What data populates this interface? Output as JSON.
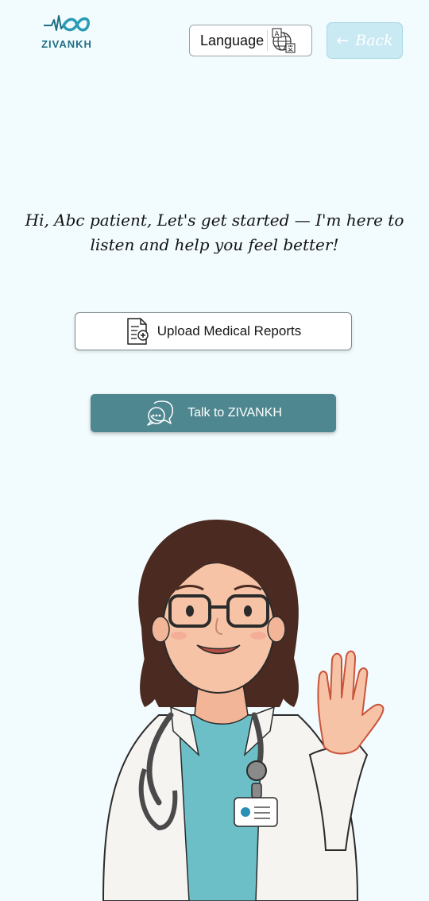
{
  "header": {
    "logo_text": "ZIVANKH",
    "language_label": "Language",
    "back_label": "Back",
    "back_arrow": "←"
  },
  "main": {
    "greeting_line1": "Hi, Abc patient, Let's get started — I'm here to",
    "greeting_line2": "listen and help you feel better!",
    "upload_label": "Upload Medical Reports",
    "talk_label": "Talk to ZIVANKH"
  },
  "colors": {
    "background": "#f2fbfd",
    "brand": "#1f6f84",
    "back_button": "#c9e9f3",
    "talk_button": "#4f8790"
  },
  "icons": {
    "logo": "infinity-heartbeat-icon",
    "language": "translate-globe-icon",
    "upload": "medical-document-icon",
    "talk": "chat-bubble-icon"
  }
}
